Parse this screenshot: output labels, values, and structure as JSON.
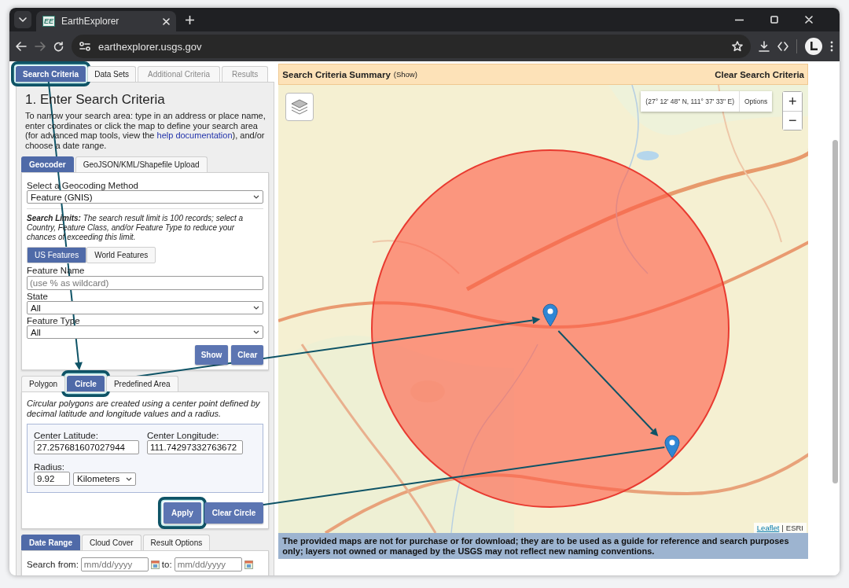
{
  "browser": {
    "favicon_text": "EE",
    "tab_title": "EarthExplorer",
    "url": "earthexplorer.usgs.gov"
  },
  "main_tabs": [
    {
      "label": "Search Criteria",
      "selected": true,
      "disabled": false
    },
    {
      "label": "Data Sets",
      "selected": false,
      "disabled": false
    },
    {
      "label": "Additional Criteria",
      "selected": false,
      "disabled": true
    },
    {
      "label": "Results",
      "selected": false,
      "disabled": true
    }
  ],
  "heading": "1. Enter Search Criteria",
  "intro": {
    "before": "To narrow your search area: type in an address or place name, enter coordinates or click the map to define your search area (for advanced map tools, view the ",
    "link": "help documentation",
    "after": "), and/or choose a date range."
  },
  "search_tabs": [
    {
      "label": "Geocoder",
      "selected": true
    },
    {
      "label": "GeoJSON/KML/Shapefile Upload",
      "selected": false
    }
  ],
  "geocoder": {
    "method_label": "Select a Geocoding Method",
    "method_value": "Feature (GNIS)",
    "limits": "**Search Limits:** The search result limit is 100 records; select a Country, Feature Class, and/or Feature Type to reduce your chances of exceeding this limit.",
    "feature_tabs": [
      {
        "label": "US Features",
        "selected": true
      },
      {
        "label": "World Features",
        "selected": false
      }
    ],
    "fields": [
      {
        "kind": "text",
        "label": "Feature Name",
        "placeholder": "(use % as wildcard)"
      },
      {
        "kind": "select",
        "label": "State",
        "value": "All"
      },
      {
        "kind": "select",
        "label": "Feature Type",
        "value": "All"
      }
    ],
    "buttons": [
      "Show",
      "Clear"
    ]
  },
  "area_tabs": [
    {
      "label": "Polygon",
      "selected": false
    },
    {
      "label": "Circle",
      "selected": true
    },
    {
      "label": "Predefined Area",
      "selected": false
    }
  ],
  "circle": {
    "description": "Circular polygons are created using a center point defined by decimal latitude and longitude values and a radius.",
    "latitude_label": "Center Latitude:",
    "latitude": "27.257681607027944",
    "longitude_label": "Center Longitude:",
    "longitude": "111.74297332763672",
    "radius_label": "Radius:",
    "radius": "9.92",
    "unit": "Kilometers",
    "buttons": [
      "Apply",
      "Clear Circle"
    ]
  },
  "date_tabs": [
    {
      "label": "Date Range",
      "selected": true
    },
    {
      "label": "Cloud Cover",
      "selected": false
    },
    {
      "label": "Result Options",
      "selected": false
    }
  ],
  "date": {
    "from_label": "Search from:",
    "from_placeholder": "mm/dd/yyyy",
    "to_label": "to:",
    "to_placeholder": "mm/dd/yyyy"
  },
  "map": {
    "summary_title": "Search Criteria Summary",
    "summary_toggle": "(Show)",
    "clear": "Clear Search Criteria",
    "coordinates": "(27° 12' 48\" N, 111° 37' 33\" E)",
    "options": "Options",
    "zoom_in": "+",
    "zoom_out": "−",
    "attribution": {
      "link": "Leaflet",
      "separator": "|",
      "source": "ESRI"
    }
  },
  "disclaimer": "The provided maps are not for purchase or for download; they are to be used as a guide for reference and search purposes only; layers not owned or managed by the USGS may not reflect new naming conventions."
}
